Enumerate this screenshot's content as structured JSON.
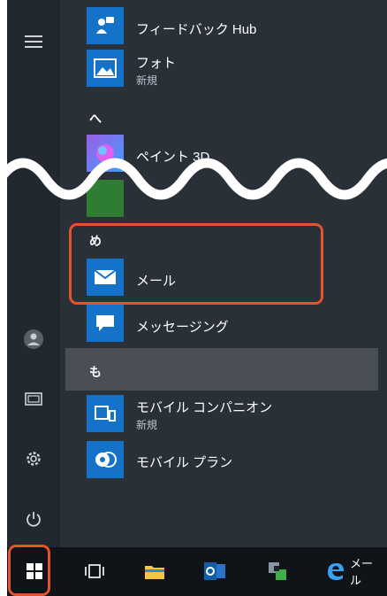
{
  "apps": {
    "feedback": {
      "name": "フィードバック Hub"
    },
    "photos": {
      "name": "フォト",
      "sub": "新規"
    },
    "section_a": "へ",
    "paint3d": {
      "name": "ペイント 3D"
    },
    "section_me": "め",
    "mail": {
      "name": "メール"
    },
    "messaging": {
      "name": "メッセージング"
    },
    "section_mo": "も",
    "mobile_companion": {
      "name": "モバイル コンパニオン",
      "sub": "新規"
    },
    "mobile_plan": {
      "name": "モバイル プラン"
    }
  },
  "leftbar": {
    "icons": [
      "hamburger-menu-icon",
      "user-avatar-icon",
      "pictures-icon",
      "settings-gear-icon",
      "power-icon"
    ]
  },
  "taskbar": {
    "items": [
      "start-windows-icon",
      "task-view-icon",
      "file-explorer-icon",
      "outlook-icon",
      "app-icon",
      "edge-icon"
    ],
    "edge_label": "メール"
  },
  "colors": {
    "tile_blue": "#1572c9",
    "highlight_red": "#e2542a",
    "menu_bg": "#2a3038",
    "taskbar_bg": "#101317"
  }
}
